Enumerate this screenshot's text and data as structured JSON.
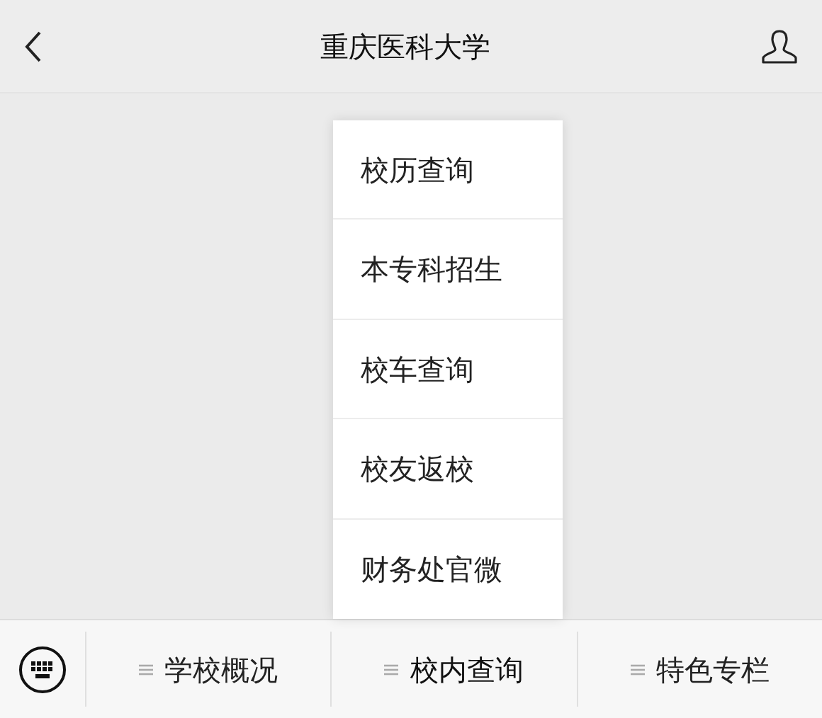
{
  "header": {
    "title": "重庆医科大学"
  },
  "menus": [
    {
      "label": "学校概况",
      "expanded": false
    },
    {
      "label": "校内查询",
      "expanded": true,
      "submenu": [
        "校历查询",
        "本专科招生",
        "校车查询",
        "校友返校",
        "财务处官微"
      ]
    },
    {
      "label": "特色专栏",
      "expanded": false
    }
  ]
}
